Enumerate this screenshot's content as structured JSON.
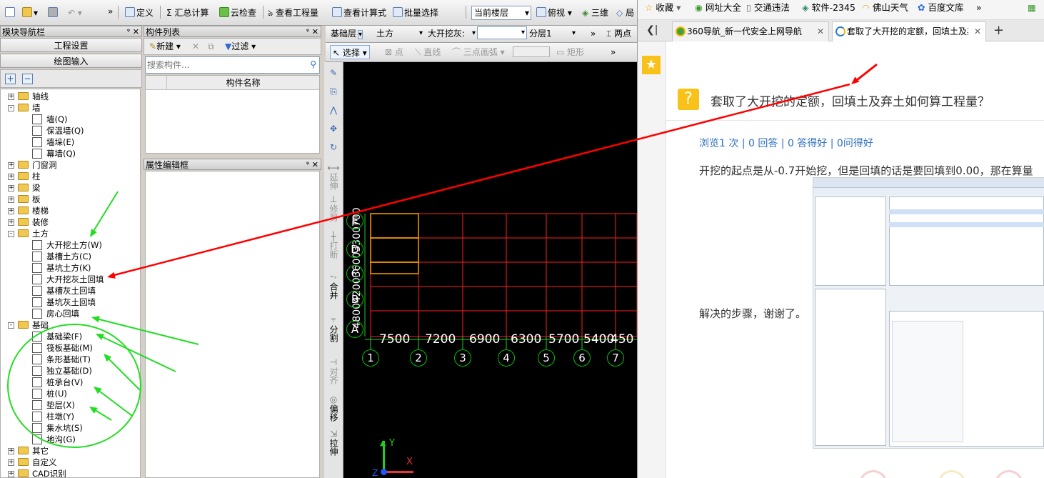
{
  "app": {
    "toolbar1": {
      "define": "定义",
      "sum": "汇总计算",
      "cloud_check": "云检查",
      "view_quantity": "查看工程量",
      "view_formula": "查看计算式",
      "batch_select": "批量选择",
      "floor": "当前楼层",
      "view": "俯视",
      "three_d": "三维",
      "more": "局"
    },
    "toolbar2": {
      "layer": "基础层",
      "type": "土方",
      "component": "大开挖灰:",
      "blank": "",
      "sublayer": "分层1",
      "two_point": "两点"
    },
    "toolbar3": {
      "select": "选择",
      "point": "点",
      "line": "直线",
      "arc": "三点画弧",
      "rect": "矩形"
    },
    "nav_panel": {
      "title": "模块导航栏",
      "project_settings": "工程设置",
      "drawing_input": "绘图输入"
    },
    "tree": [
      {
        "label": "轴线",
        "level": 0,
        "expand": "+",
        "kind": "folder"
      },
      {
        "label": "墙",
        "level": 0,
        "expand": "-",
        "kind": "folder"
      },
      {
        "label": "墙(Q)",
        "level": 1,
        "kind": "leaf"
      },
      {
        "label": "保温墙(Q)",
        "level": 1,
        "kind": "leaf"
      },
      {
        "label": "墙垛(E)",
        "level": 1,
        "kind": "leaf"
      },
      {
        "label": "幕墙(Q)",
        "level": 1,
        "kind": "leaf"
      },
      {
        "label": "门窗洞",
        "level": 0,
        "expand": "+",
        "kind": "folder"
      },
      {
        "label": "柱",
        "level": 0,
        "expand": "+",
        "kind": "folder"
      },
      {
        "label": "梁",
        "level": 0,
        "expand": "+",
        "kind": "folder"
      },
      {
        "label": "板",
        "level": 0,
        "expand": "+",
        "kind": "folder"
      },
      {
        "label": "楼梯",
        "level": 0,
        "expand": "+",
        "kind": "folder"
      },
      {
        "label": "装修",
        "level": 0,
        "expand": "+",
        "kind": "folder"
      },
      {
        "label": "土方",
        "level": 0,
        "expand": "-",
        "kind": "folder"
      },
      {
        "label": "大开挖土方(W)",
        "level": 1,
        "kind": "leaf"
      },
      {
        "label": "基槽土方(C)",
        "level": 1,
        "kind": "leaf"
      },
      {
        "label": "基坑土方(K)",
        "level": 1,
        "kind": "leaf"
      },
      {
        "label": "大开挖灰土回填",
        "level": 1,
        "kind": "leaf"
      },
      {
        "label": "基槽灰土回填",
        "level": 1,
        "kind": "leaf"
      },
      {
        "label": "基坑灰土回填",
        "level": 1,
        "kind": "leaf"
      },
      {
        "label": "房心回填",
        "level": 1,
        "kind": "leaf"
      },
      {
        "label": "基础",
        "level": 0,
        "expand": "-",
        "kind": "folder"
      },
      {
        "label": "基础梁(F)",
        "level": 1,
        "kind": "leaf"
      },
      {
        "label": "筏板基础(M)",
        "level": 1,
        "kind": "leaf"
      },
      {
        "label": "条形基础(T)",
        "level": 1,
        "kind": "leaf"
      },
      {
        "label": "独立基础(D)",
        "level": 1,
        "kind": "leaf"
      },
      {
        "label": "桩承台(V)",
        "level": 1,
        "kind": "leaf"
      },
      {
        "label": "桩(U)",
        "level": 1,
        "kind": "leaf"
      },
      {
        "label": "垫层(X)",
        "level": 1,
        "kind": "leaf"
      },
      {
        "label": "柱墩(Y)",
        "level": 1,
        "kind": "leaf"
      },
      {
        "label": "集水坑(S)",
        "level": 1,
        "kind": "leaf"
      },
      {
        "label": "地沟(G)",
        "level": 1,
        "kind": "leaf"
      },
      {
        "label": "其它",
        "level": 0,
        "expand": "+",
        "kind": "folder"
      },
      {
        "label": "自定义",
        "level": 0,
        "expand": "+",
        "kind": "folder"
      },
      {
        "label": "CAD识别",
        "level": 0,
        "expand": "+",
        "kind": "folder"
      }
    ],
    "component_panel": {
      "title": "构件列表",
      "new": "新建",
      "filter": "过滤",
      "search_placeholder": "搜索构件...",
      "col_name": "构件名称"
    },
    "property_panel": {
      "title": "属性编辑框"
    },
    "vtools": [
      "延伸",
      "修剪",
      "打断",
      "合并",
      "分割",
      "对齐",
      "偏移",
      "拉伸"
    ],
    "cad": {
      "x_dims": [
        "7500",
        "7200",
        "6900",
        "6300",
        "5700",
        "5400",
        "450"
      ],
      "x_axes": [
        "1",
        "2",
        "3",
        "4",
        "5",
        "6",
        "7"
      ],
      "y_axes": [
        "A",
        "B",
        "C",
        "D",
        "E"
      ],
      "y_dims_text": "4800420036003300700",
      "ucs_x": "X",
      "ucs_y": "Y",
      "ucs_z": "Z"
    }
  },
  "browser": {
    "favorites": [
      "收藏",
      "网址大全",
      "交通违法",
      "软件-2345",
      "佛山天气",
      "百度文库"
    ],
    "more": "»",
    "tabs": [
      {
        "label": "360导航_新一代安全上网导航"
      },
      {
        "label": "套取了大开挖的定额，回填土及弃"
      }
    ],
    "question": {
      "title": "套取了大开挖的定额，回填土及弃土如何算工程量？",
      "stats": "浏览1 次 | 0 回答 | 0 答得好 | 0问得好",
      "body1": "开挖的起点是从-0.7开始挖，但是回填的话是要回填到0.00，那在算量",
      "body2": "解决的步骤，谢谢了。"
    },
    "colors": {
      "link": "#2f6fbe",
      "accent": "#ff0000",
      "annot": "#22dd22"
    }
  }
}
